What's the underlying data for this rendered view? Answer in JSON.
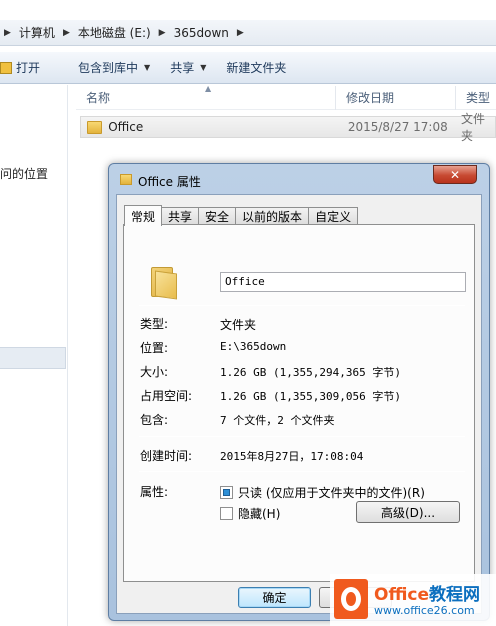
{
  "explorer": {
    "breadcrumb": [
      "计算机",
      "本地磁盘 (E:)",
      "365down"
    ],
    "toolbar": {
      "open": "打开",
      "include_library": "包含到库中",
      "share": "共享",
      "new_folder": "新建文件夹"
    },
    "nav_partial_label": "问的位置",
    "columns": {
      "name": "名称",
      "date": "修改日期",
      "type": "类型"
    },
    "file": {
      "name": "Office",
      "date": "2015/8/27 17:08",
      "type": "文件夹"
    }
  },
  "dialog": {
    "title": "Office 属性",
    "close_glyph": "✕",
    "tabs": [
      "常规",
      "共享",
      "安全",
      "以前的版本",
      "自定义"
    ],
    "active_tab": "常规",
    "folder_name": "Office",
    "props": {
      "type_label": "类型:",
      "type_value": "文件夹",
      "location_label": "位置:",
      "location_value": "E:\\365down",
      "size_label": "大小:",
      "size_value": "1.26 GB (1,355,294,365 字节)",
      "disk_size_label": "占用空间:",
      "disk_size_value": "1.26 GB (1,355,309,056 字节)",
      "contains_label": "包含:",
      "contains_value": "7 个文件，2 个文件夹",
      "created_label": "创建时间:",
      "created_value": "2015年8月27日，17:08:04",
      "attributes_label": "属性:"
    },
    "attributes": {
      "readonly_label": "只读 (仅应用于文件夹中的文件)(R)",
      "readonly_state": "indeterminate",
      "hidden_label": "隐藏(H)",
      "hidden_state": "unchecked",
      "advanced_label": "高级(D)..."
    },
    "buttons": {
      "ok": "确定",
      "cancel": ""
    }
  },
  "watermark": {
    "title_a": "Office",
    "title_b": "教程网",
    "url": "www.office26.com"
  },
  "colors": {
    "accent": "#2d8fd6",
    "close": "#c74a32",
    "brand_orange": "#f05a1e",
    "brand_blue": "#0c6fbf"
  }
}
